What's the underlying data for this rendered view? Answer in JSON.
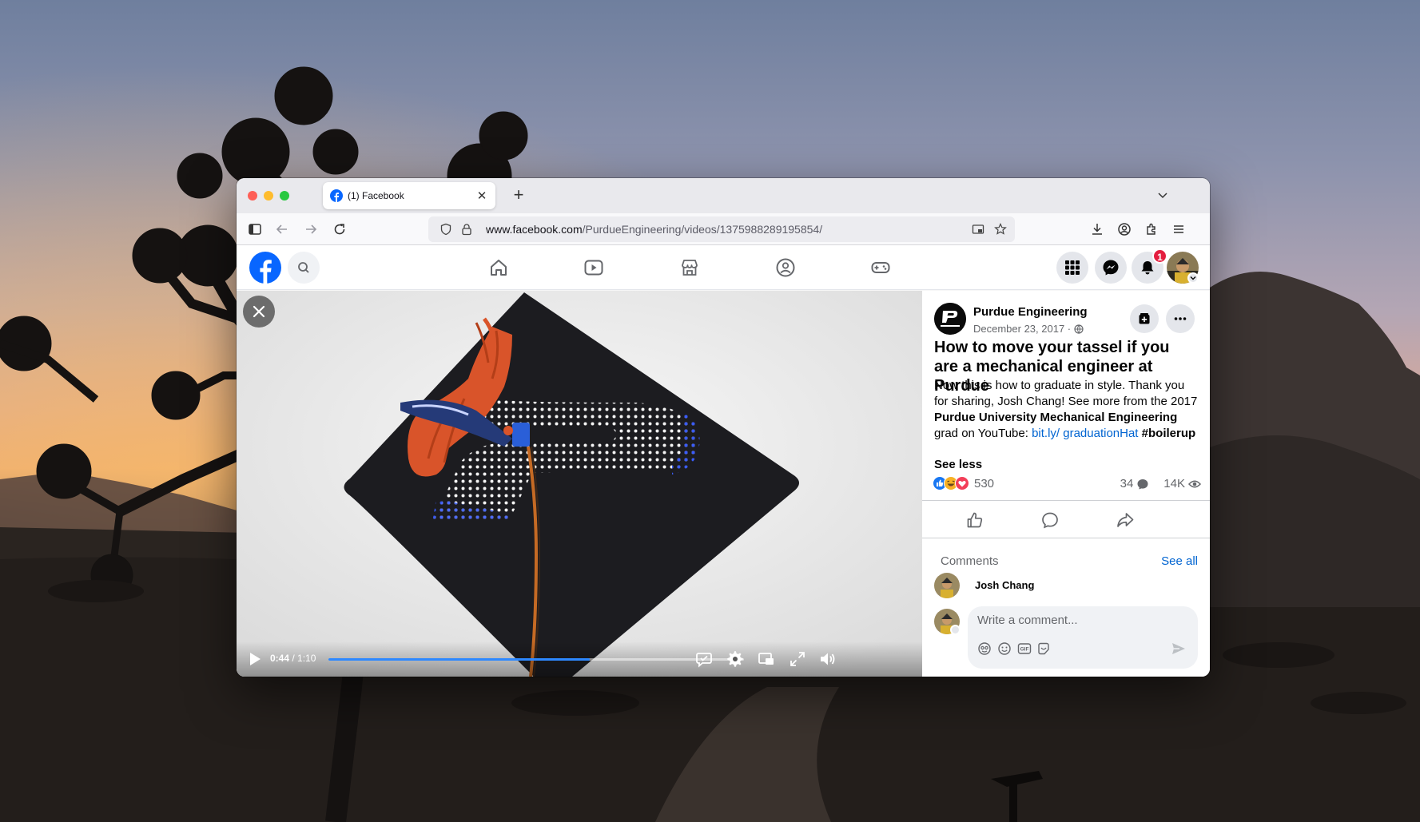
{
  "browser": {
    "tab_title": "(1) Facebook",
    "url_host": "www.facebook.com",
    "url_path": "/PurdueEngineering/videos/1375988289195854/"
  },
  "facebook": {
    "notification_count": "1"
  },
  "video": {
    "current_time": "0:44",
    "duration": "/ 1:10",
    "progress_fraction": 0.629
  },
  "post": {
    "page_name": "Purdue Engineering",
    "date": "December 23, 2017 ·",
    "title": "How to move your tassel if you are a mechanical engineer at Purdue",
    "body_1": "Now this is how to graduate in style. Thank you for sharing, Josh Chang! See more from the 2017 ",
    "body_bold": "Purdue University Mechanical Engineering",
    "body_2": " grad on YouTube: ",
    "body_link": "bit.ly/ graduationHat",
    "body_3": " #boilerup",
    "see_less": "See less",
    "reaction_count": "530",
    "comment_count": "34",
    "view_count": "14K"
  },
  "comments": {
    "label": "Comments",
    "see_all": "See all",
    "first_commenter": "Josh Chang",
    "input_placeholder": "Write a comment..."
  },
  "colors": {
    "facebook_blue": "#0866ff",
    "link_blue": "#0064d1",
    "progress_blue": "#2d88ff",
    "notification_red": "#e41e3f"
  }
}
